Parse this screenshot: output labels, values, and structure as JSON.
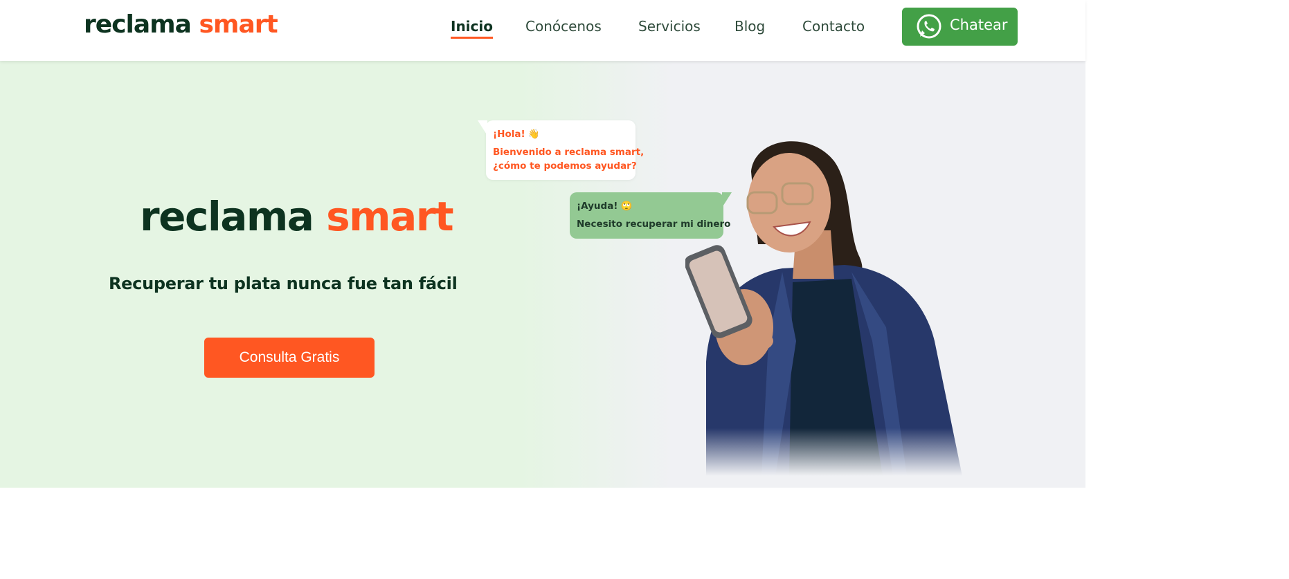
{
  "header": {
    "logo": {
      "part1": "reclama",
      "part2": "smart"
    },
    "nav": [
      {
        "label": "Inicio",
        "active": true
      },
      {
        "label": "Conócenos",
        "active": false
      },
      {
        "label": "Servicios",
        "active": false
      },
      {
        "label": "Blog",
        "active": false
      },
      {
        "label": "Contacto",
        "active": false
      }
    ],
    "chat_button": {
      "label": "Chatear",
      "icon": "whatsapp-icon"
    }
  },
  "hero": {
    "logo": {
      "part1": "reclama",
      "part2": "smart"
    },
    "tagline": "Recuperar tu plata nunca fue tan fácil",
    "cta_label": "Consulta Gratis",
    "bubble_bot": {
      "greeting": "¡Hola!",
      "greeting_emoji": "👋",
      "line1": "Bienvenido a reclama smart,",
      "line2": "¿cómo te podemos ayudar?"
    },
    "bubble_user": {
      "greeting": "¡Ayuda!",
      "greeting_emoji": "🙄",
      "line1": "Necesito recuperar mi dinero"
    },
    "photo_alt": "woman-smiling-with-phone"
  },
  "colors": {
    "brand_dark": "#0d3320",
    "brand_orange": "#ff5722",
    "whatsapp_green": "#43a047",
    "hero_bg": "#e5f5e3"
  }
}
